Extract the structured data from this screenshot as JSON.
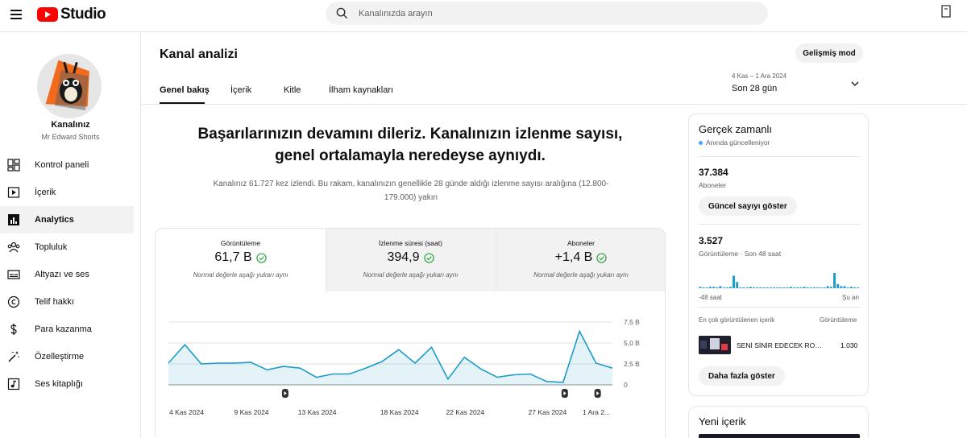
{
  "app": {
    "logo_text": "Studio"
  },
  "search": {
    "placeholder": "Kanalınızda arayın"
  },
  "channel": {
    "title": "Kanalınız",
    "name": "Mr Edward Shorts"
  },
  "sidebar": {
    "items": [
      {
        "label": "Kontrol paneli",
        "icon": "dashboard-icon"
      },
      {
        "label": "İçerik",
        "icon": "content-icon"
      },
      {
        "label": "Analytics",
        "icon": "analytics-icon",
        "active": true
      },
      {
        "label": "Topluluk",
        "icon": "community-icon"
      },
      {
        "label": "Altyazı ve ses",
        "icon": "subtitles-icon"
      },
      {
        "label": "Telif hakkı",
        "icon": "copyright-icon"
      },
      {
        "label": "Para kazanma",
        "icon": "dollar-icon"
      },
      {
        "label": "Özelleştirme",
        "icon": "magic-wand-icon"
      },
      {
        "label": "Ses kitaplığı",
        "icon": "audio-library-icon"
      }
    ]
  },
  "header": {
    "title": "Kanal analizi",
    "advanced_button": "Gelişmiş mod",
    "tabs": [
      {
        "label": "Genel bakış",
        "active": true
      },
      {
        "label": "İçerik"
      },
      {
        "label": "Kitle"
      },
      {
        "label": "İlham kaynakları"
      }
    ],
    "date_range": "4 Kas – 1 Ara 2024",
    "date_period": "Son 28 gün"
  },
  "summary": {
    "headline_line1": "Başarılarınızın devamını dileriz. Kanalınızın izlenme sayısı,",
    "headline_line2": "genel ortalamayla neredeyse aynıydı.",
    "sub_line1": "Kanalınız 61.727 kez izlendi. Bu rakam, kanalınızın genellikle 28 günde aldığı izlenme sayısı aralığına (12.800-",
    "sub_line2": "179.000) yakın"
  },
  "metrics": [
    {
      "label": "Görüntüleme",
      "value": "61,7 B",
      "note": "Normal değerle aşağı yukarı aynı"
    },
    {
      "label": "İzlenme süresi (saat)",
      "value": "394,9",
      "note": "Normal değerle aşağı yukarı aynı"
    },
    {
      "label": "Aboneler",
      "value": "+1,4 B",
      "note": "Normal değerle aşağı yukarı aynı"
    }
  ],
  "chart_data": {
    "type": "area",
    "series": [
      {
        "values": [
          2.6,
          4.8,
          2.5,
          2.6,
          2.6,
          2.7,
          1.8,
          2.2,
          2.0,
          0.9,
          1.3,
          1.3,
          2.0,
          2.8,
          4.2,
          2.6,
          4.5,
          0.7,
          3.3,
          1.9,
          0.9,
          1.2,
          1.3,
          0.4,
          0.3,
          6.4,
          2.6,
          2.0
        ]
      }
    ],
    "x_tick_labels": [
      "4 Kas 2024",
      "9 Kas 2024",
      "13 Kas 2024",
      "18 Kas 2024",
      "22 Kas 2024",
      "27 Kas 2024",
      "1 Ara 2..."
    ],
    "y_tick_labels": [
      "7,5 B",
      "5,0 B",
      "2,5 B",
      "0"
    ],
    "ylim": [
      0,
      7.5
    ],
    "grid": true,
    "color": "#1d9bc9"
  },
  "realtime": {
    "title": "Gerçek zamanlı",
    "live_text": "Anında güncelleniyor",
    "subscribers": "37.384",
    "subscribers_label": "Aboneler",
    "show_count_button": "Güncel sayıyı göster",
    "views": "3.527",
    "views_label": "Görüntüleme · Son 48 saat",
    "axis_left": "-48 saat",
    "axis_right": "Şu an",
    "bars": [
      2,
      1,
      1,
      2,
      2,
      1,
      3,
      1,
      1,
      2,
      18,
      9,
      1,
      1,
      1,
      2,
      1,
      1,
      1,
      1,
      1,
      1,
      1,
      1,
      1,
      1,
      1,
      2,
      1,
      1,
      1,
      2,
      1,
      1,
      1,
      1,
      1,
      1,
      3,
      2,
      22,
      6,
      3,
      3,
      1,
      2,
      1,
      1
    ],
    "top_header": "En çok görüntülenen içerik",
    "top_header_right": "Görüntüleme",
    "top_video_title": "SENİ SİNİR EDECEK ROBOT",
    "top_video_views": "1.030",
    "more_button": "Daha fazla göster"
  },
  "new_content": {
    "title": "Yeni içerik"
  },
  "colors": {
    "brand_red": "#ff0000",
    "accent_blue": "#3ea6ff",
    "chart_line": "#1d9bc9",
    "check_green": "#2ba640"
  }
}
